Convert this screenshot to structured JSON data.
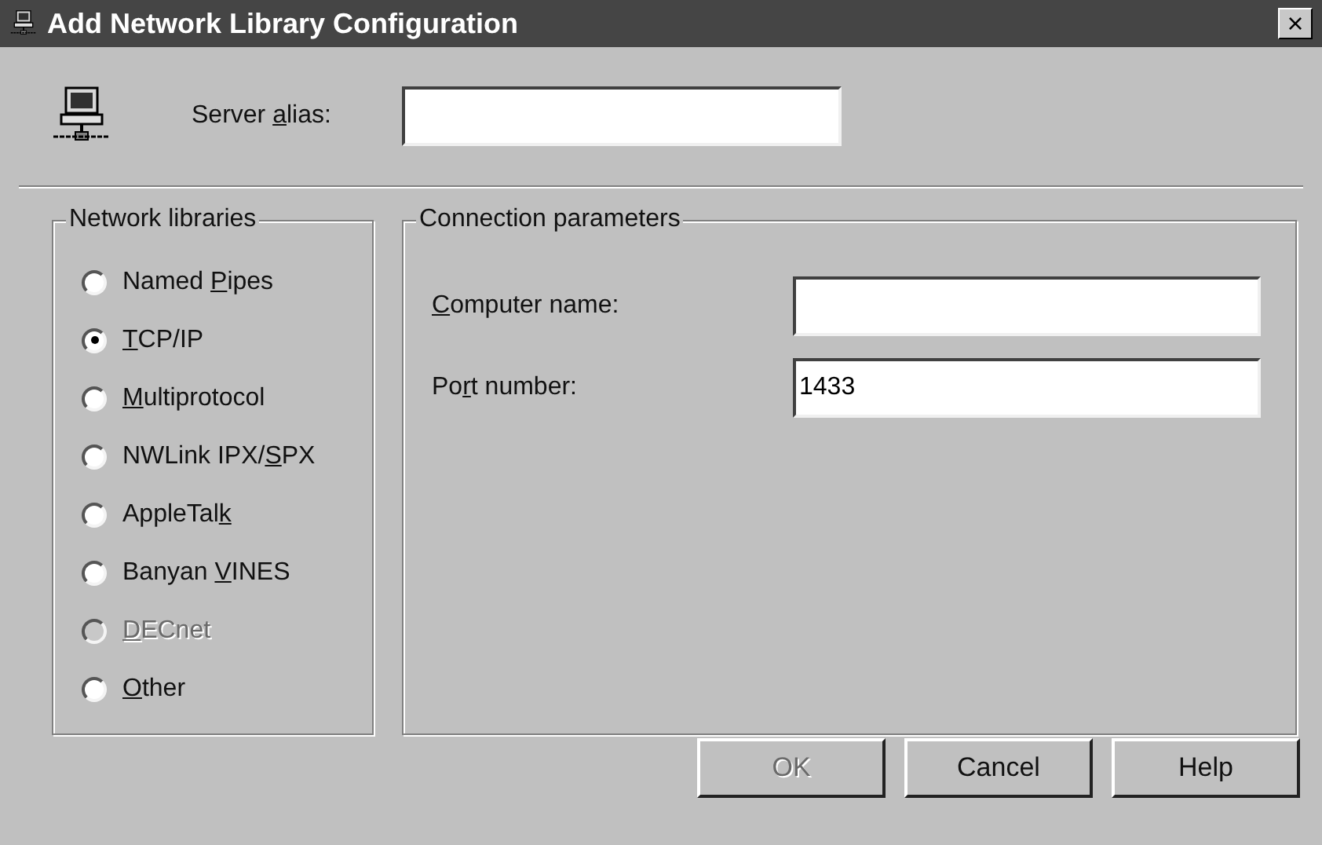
{
  "window": {
    "title": "Add Network Library Configuration",
    "close": "×"
  },
  "server_alias": {
    "label": {
      "pre": "Server ",
      "key": "a",
      "post": "lias:"
    }
  },
  "network_libraries": {
    "title": "Network libraries",
    "options": [
      {
        "label": {
          "pre": "Named ",
          "key": "P",
          "post": "ipes"
        },
        "selected": false,
        "disabled": false
      },
      {
        "label": {
          "key": "T",
          "post": "CP/IP"
        },
        "selected": true,
        "disabled": false
      },
      {
        "label": {
          "key": "M",
          "post": "ultiprotocol"
        },
        "selected": false,
        "disabled": false
      },
      {
        "label": {
          "pre": "NWLink IPX/",
          "key": "S",
          "post": "PX"
        },
        "selected": false,
        "disabled": false
      },
      {
        "label": {
          "pre": "AppleTal",
          "key": "k"
        },
        "selected": false,
        "disabled": false
      },
      {
        "label": {
          "pre": "Banyan ",
          "key": "V",
          "post": "INES"
        },
        "selected": false,
        "disabled": false
      },
      {
        "label": {
          "key": "D",
          "post": "ECnet"
        },
        "selected": false,
        "disabled": true
      },
      {
        "label": {
          "key": "O",
          "post": "ther"
        },
        "selected": false,
        "disabled": false
      }
    ]
  },
  "connection_parameters": {
    "title": "Connection parameters",
    "fields": [
      {
        "label": {
          "key": "C",
          "post": "omputer name:"
        }
      },
      {
        "label": {
          "pre": "Po",
          "key": "r",
          "post": "t number:"
        },
        "value": "1433"
      }
    ]
  },
  "buttons": [
    {
      "label": "OK",
      "disabled": true
    },
    {
      "label": "Cancel",
      "disabled": false
    },
    {
      "label": "Help",
      "disabled": false
    }
  ]
}
